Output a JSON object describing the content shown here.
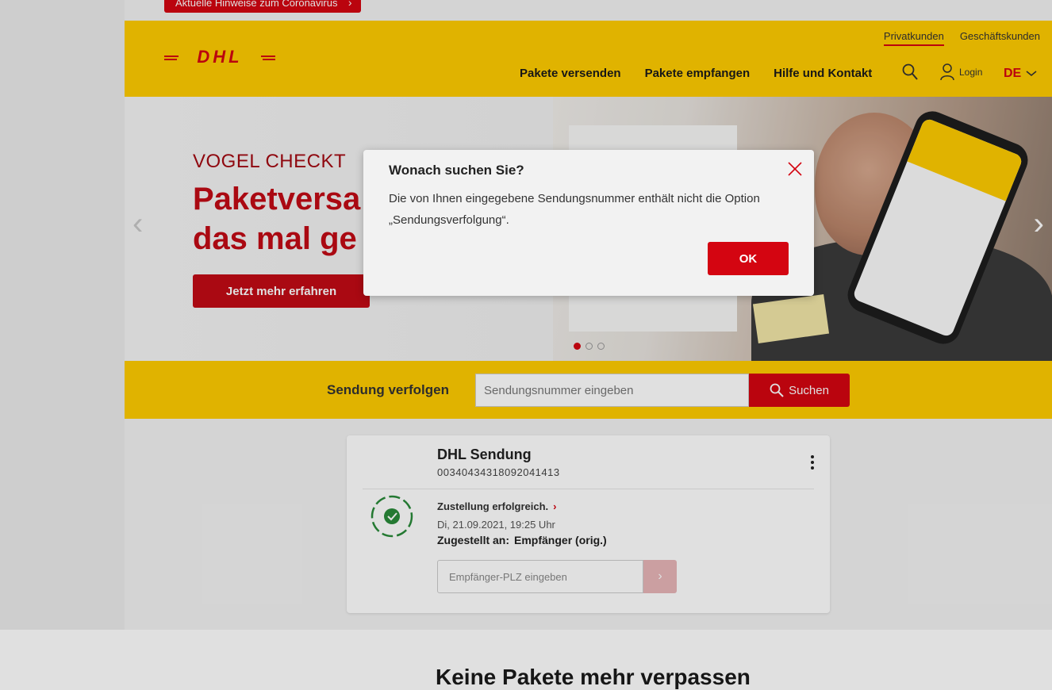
{
  "colors": {
    "brand_yellow": "#ffcc00",
    "brand_red": "#d40511",
    "success_green": "#2a8a3a"
  },
  "corona": {
    "label": "Aktuelle Hinweise zum Coronavirus"
  },
  "header": {
    "logo_text": "DHL",
    "top_links": {
      "private": "Privatkunden",
      "business": "Geschäftskunden"
    },
    "nav": {
      "send": "Pakete versenden",
      "receive": "Pakete empfangen",
      "help": "Hilfe und Kontakt"
    },
    "login": "Login",
    "language": "DE"
  },
  "hero": {
    "kicker": "VOGEL CHECKT",
    "title": "Paketversa\ndas mal ge",
    "cta": "Jetzt mehr erfahren",
    "slides_total": 3,
    "active_slide": 1
  },
  "tracking": {
    "label": "Sendung verfolgen",
    "placeholder": "Sendungsnummer eingeben",
    "button": "Suchen"
  },
  "shipment": {
    "title": "DHL Sendung",
    "number": "00340434318092041413",
    "status": "Zustellung erfolgreich.",
    "date": "Di, 21.09.2021, 19:25 Uhr",
    "delivered_to_label": "Zugestellt an:",
    "delivered_to_value": "Empfänger (orig.)",
    "plz_placeholder": "Empfänger-PLZ eingeben"
  },
  "section": {
    "heading": "Keine Pakete mehr verpassen"
  },
  "dialog": {
    "title": "Wonach suchen Sie?",
    "message": "Die von Ihnen eingegebene Sendungsnummer enthält nicht die Option „Sendungsverfolgung“.",
    "ok": "OK"
  }
}
